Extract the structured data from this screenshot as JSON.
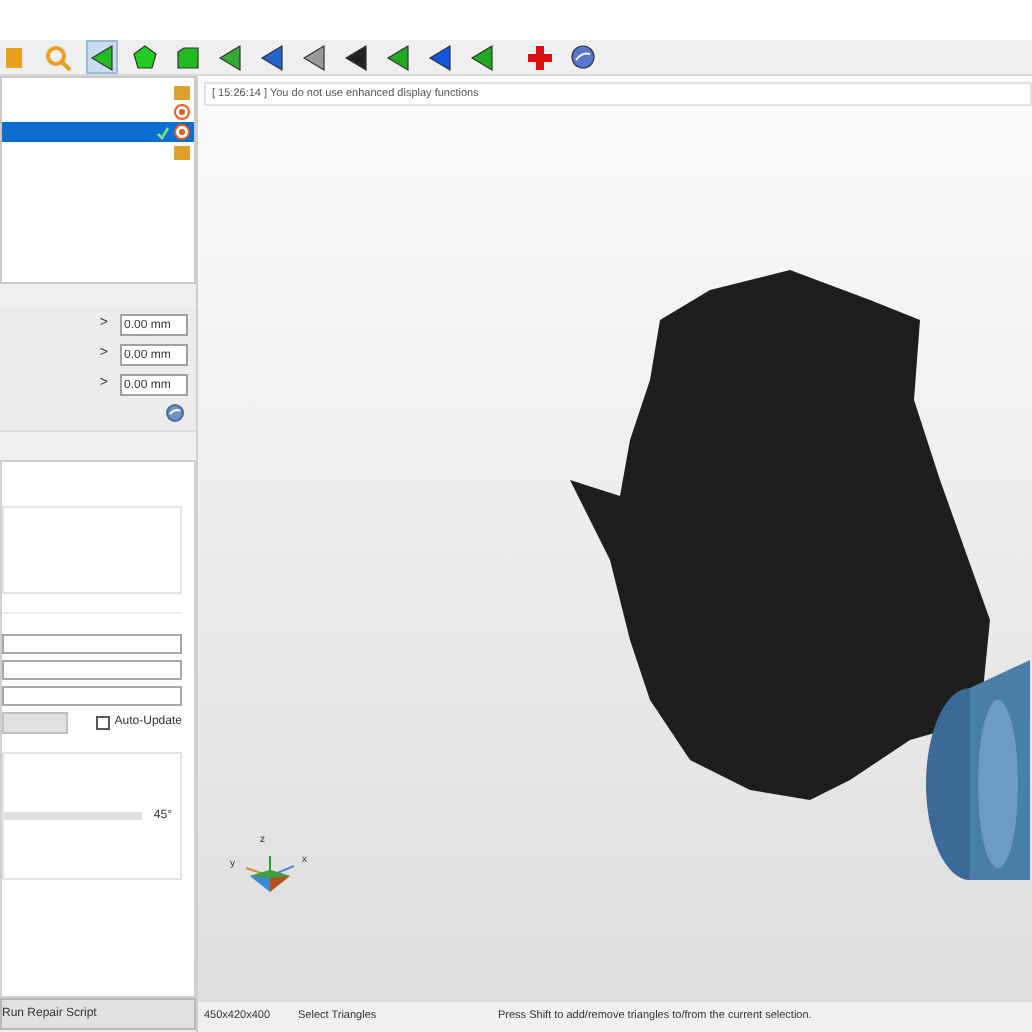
{
  "toolbar": [
    {
      "kind": "folder",
      "selected": false
    },
    {
      "kind": "zoom",
      "selected": false
    },
    {
      "kind": "tri",
      "color": "#22bb22",
      "selected": true
    },
    {
      "kind": "pentagon",
      "color": "#22cc22",
      "selected": false
    },
    {
      "kind": "square",
      "color": "#22bb22",
      "selected": false
    },
    {
      "kind": "tri",
      "color": "#33aa33",
      "selected": false
    },
    {
      "kind": "tri",
      "color": "#2266cc",
      "selected": false
    },
    {
      "kind": "tri",
      "color": "#999999",
      "selected": false
    },
    {
      "kind": "tri",
      "color": "#222222",
      "selected": false
    },
    {
      "kind": "tri",
      "color": "#22aa22",
      "selected": false
    },
    {
      "kind": "tri",
      "color": "#1155dd",
      "selected": false
    },
    {
      "kind": "tri",
      "color": "#22aa22",
      "selected": false
    },
    {
      "kind": "cross",
      "selected": false
    },
    {
      "kind": "globe",
      "selected": false
    }
  ],
  "tree": [
    {
      "kind": "folder",
      "selected": false,
      "checked": false
    },
    {
      "kind": "target",
      "selected": false,
      "checked": false
    },
    {
      "kind": "target",
      "selected": true,
      "checked": true
    },
    {
      "kind": "folder",
      "selected": false,
      "checked": false
    }
  ],
  "offsets": [
    {
      "arrow": ">",
      "value": "0.00 mm"
    },
    {
      "arrow": ">",
      "value": "0.00 mm"
    },
    {
      "arrow": ">",
      "value": "0.00 mm"
    }
  ],
  "auto_update": {
    "label": "Auto-Update",
    "checked": false
  },
  "angle": {
    "reading": "45°"
  },
  "run_button": "Run Repair Script",
  "log": "[ 15:26:14 ] You do not use enhanced display functions",
  "axes": {
    "x": "x",
    "y": "y",
    "z": "z"
  },
  "status_bar": [
    "450x420x400",
    "Select Triangles",
    "Press Shift to add/remove triangles to/from the current selection."
  ]
}
